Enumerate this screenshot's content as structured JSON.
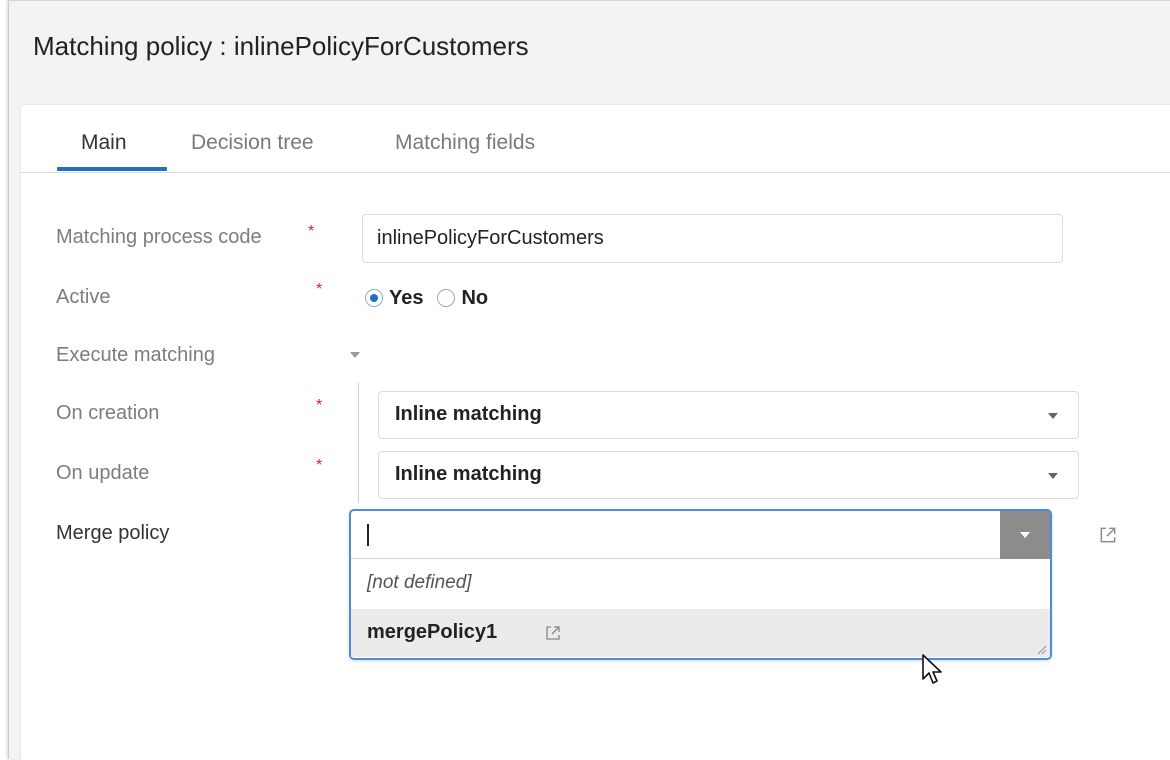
{
  "window": {
    "title_prefix": "Matching",
    "title_suffix": "policy : inlinePolicyForCustomers"
  },
  "tabs": [
    {
      "label": "Main",
      "active": true
    },
    {
      "label": "Decision tree",
      "active": false
    },
    {
      "label": "Matching fields",
      "active": false
    }
  ],
  "form": {
    "process_code": {
      "label": "Matching process code",
      "required_mark": "*",
      "value": "inlinePolicyForCustomers"
    },
    "active": {
      "label": "Active",
      "required_mark": "*",
      "options": [
        "Yes",
        "No"
      ],
      "selected": "Yes"
    },
    "execute_matching": {
      "label": "Execute matching"
    },
    "on_creation": {
      "label": "On creation",
      "required_mark": "*",
      "value": "Inline matching"
    },
    "on_update": {
      "label": "On update",
      "required_mark": "*",
      "value": "Inline matching"
    },
    "merge_policy": {
      "label": "Merge policy",
      "input_value": "",
      "options": [
        "[not defined]",
        "mergePolicy1"
      ],
      "highlighted": "mergePolicy1"
    }
  },
  "icons": {
    "external_link": "external-link-icon",
    "dropdown": "chevron-down-icon",
    "resize": "resize-grip-icon",
    "pointer": "mouse-pointer-icon"
  },
  "colors": {
    "accent": "#1e73be",
    "required": "#d9202a",
    "focus_border": "#4a8fd6",
    "dropdown_button": "#8c8c8c"
  }
}
